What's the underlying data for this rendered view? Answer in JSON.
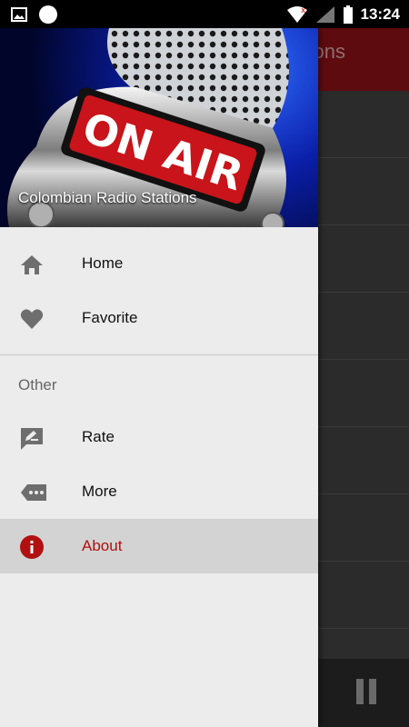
{
  "statusbar": {
    "time": "13:24",
    "icons": [
      "image-icon",
      "circle-icon",
      "wifi-icon",
      "signal-icon",
      "battery-icon"
    ]
  },
  "background_app": {
    "toolbar_title_fragment": "ons",
    "accent": "#5d0b0f"
  },
  "drawer": {
    "header_title": "Colombian Radio Stations",
    "header_image_text": "ON AIR",
    "items": [
      {
        "label": "Home",
        "icon": "home-icon"
      },
      {
        "label": "Favorite",
        "icon": "heart-icon"
      }
    ],
    "section_header": "Other",
    "other_items": [
      {
        "label": "Rate",
        "icon": "rate-icon"
      },
      {
        "label": "More",
        "icon": "more-icon"
      },
      {
        "label": "About",
        "icon": "info-icon",
        "selected": true
      }
    ],
    "selected_color": "#b01010"
  }
}
